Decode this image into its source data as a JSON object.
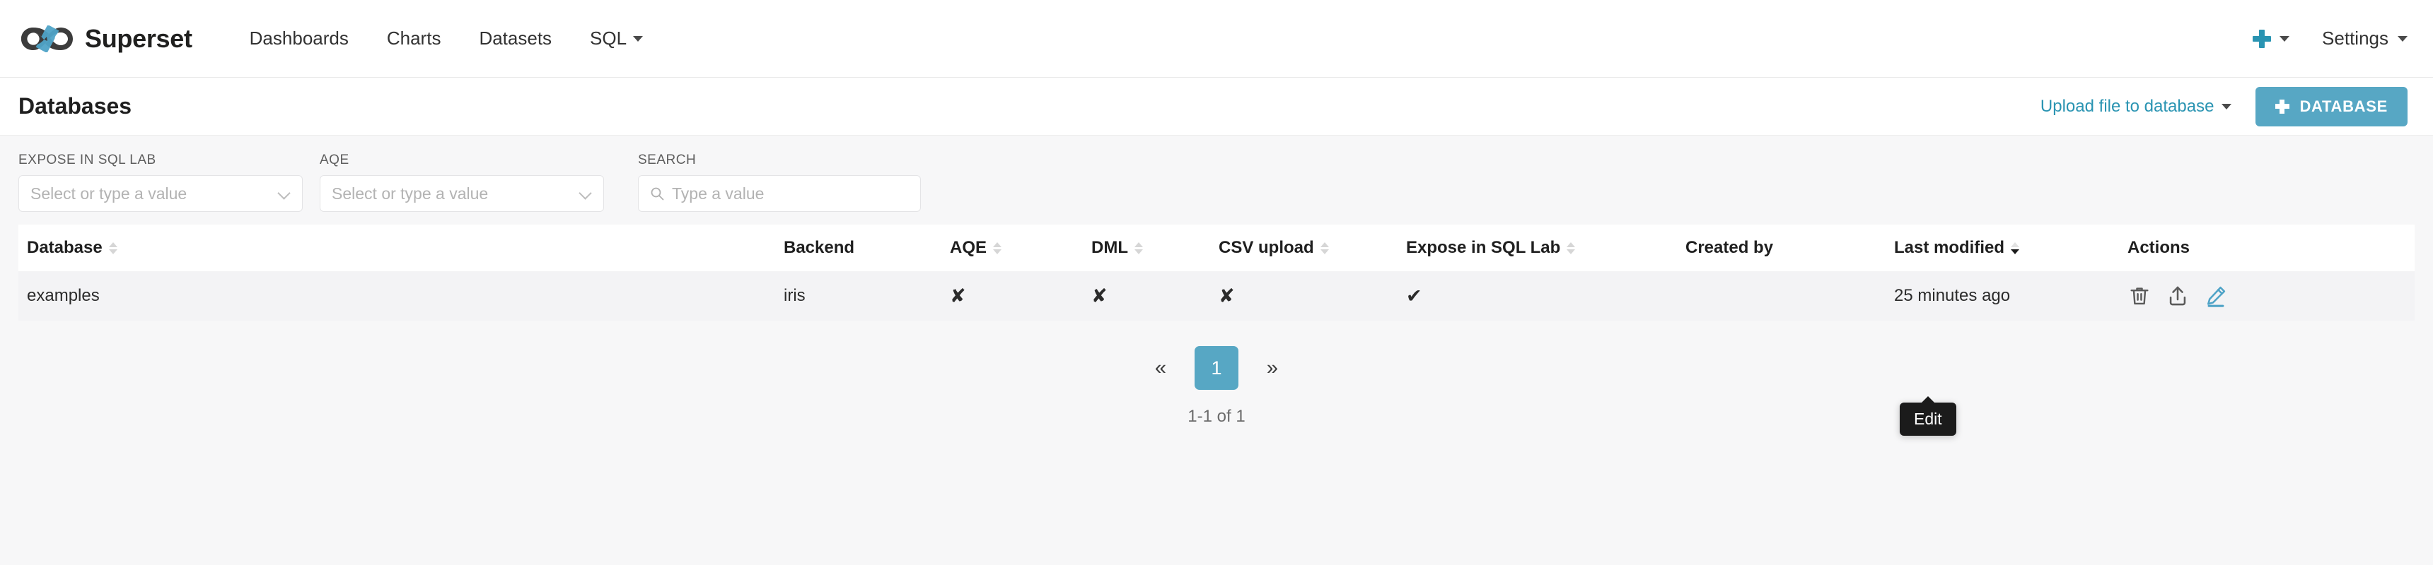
{
  "navbar": {
    "brand": "Superset",
    "brand_logo_icon": "superset-infinity-logo",
    "logo_colors": {
      "dark": "#3c3c3c",
      "accent": "#4fa3c7"
    },
    "links": [
      {
        "label": "Dashboards",
        "has_caret": false
      },
      {
        "label": "Charts",
        "has_caret": false
      },
      {
        "label": "Datasets",
        "has_caret": false
      },
      {
        "label": "SQL",
        "has_caret": true
      }
    ],
    "plus_icon": "plus-icon",
    "settings_label": "Settings"
  },
  "header": {
    "title": "Databases",
    "upload_link": "Upload file to database",
    "new_database_button": "DATABASE"
  },
  "filters": [
    {
      "label": "EXPOSE IN SQL LAB",
      "placeholder": "Select or type a value",
      "value": ""
    },
    {
      "label": "AQE",
      "placeholder": "Select or type a value",
      "value": ""
    }
  ],
  "search": {
    "label": "SEARCH",
    "placeholder": "Type a value",
    "value": "",
    "icon": "search-icon"
  },
  "table": {
    "columns": [
      {
        "key": "database",
        "label": "Database",
        "sortable": true,
        "sorted": "none"
      },
      {
        "key": "backend",
        "label": "Backend",
        "sortable": false,
        "sorted": "none"
      },
      {
        "key": "aqe",
        "label": "AQE",
        "sortable": true,
        "sorted": "none"
      },
      {
        "key": "dml",
        "label": "DML",
        "sortable": true,
        "sorted": "none"
      },
      {
        "key": "csv_upload",
        "label": "CSV upload",
        "sortable": true,
        "sorted": "none"
      },
      {
        "key": "expose",
        "label": "Expose in SQL Lab",
        "sortable": true,
        "sorted": "none"
      },
      {
        "key": "created_by",
        "label": "Created by",
        "sortable": false,
        "sorted": "none"
      },
      {
        "key": "last_modified",
        "label": "Last modified",
        "sortable": true,
        "sorted": "desc"
      },
      {
        "key": "actions",
        "label": "Actions",
        "sortable": false,
        "sorted": "none"
      }
    ],
    "rows": [
      {
        "database": "examples",
        "backend": "iris",
        "aqe": "✘",
        "dml": "✘",
        "csv_upload": "✘",
        "expose": "✔",
        "created_by": "",
        "last_modified": "25 minutes ago",
        "actions": [
          "trash-icon",
          "export-icon",
          "edit-pencil-icon"
        ]
      }
    ]
  },
  "tooltip": {
    "text": "Edit",
    "target": "edit-pencil-icon"
  },
  "pagination": {
    "prev": "«",
    "next": "»",
    "pages": [
      "1"
    ],
    "active_page": "1",
    "record_count": "1-1 of 1"
  },
  "colors": {
    "accent_teal": "#57a7c4",
    "link_teal": "#2a94b2",
    "page_bg": "#f7f7f8",
    "row_bg": "#f3f3f5",
    "tooltip_bg": "#1b1b1b"
  }
}
